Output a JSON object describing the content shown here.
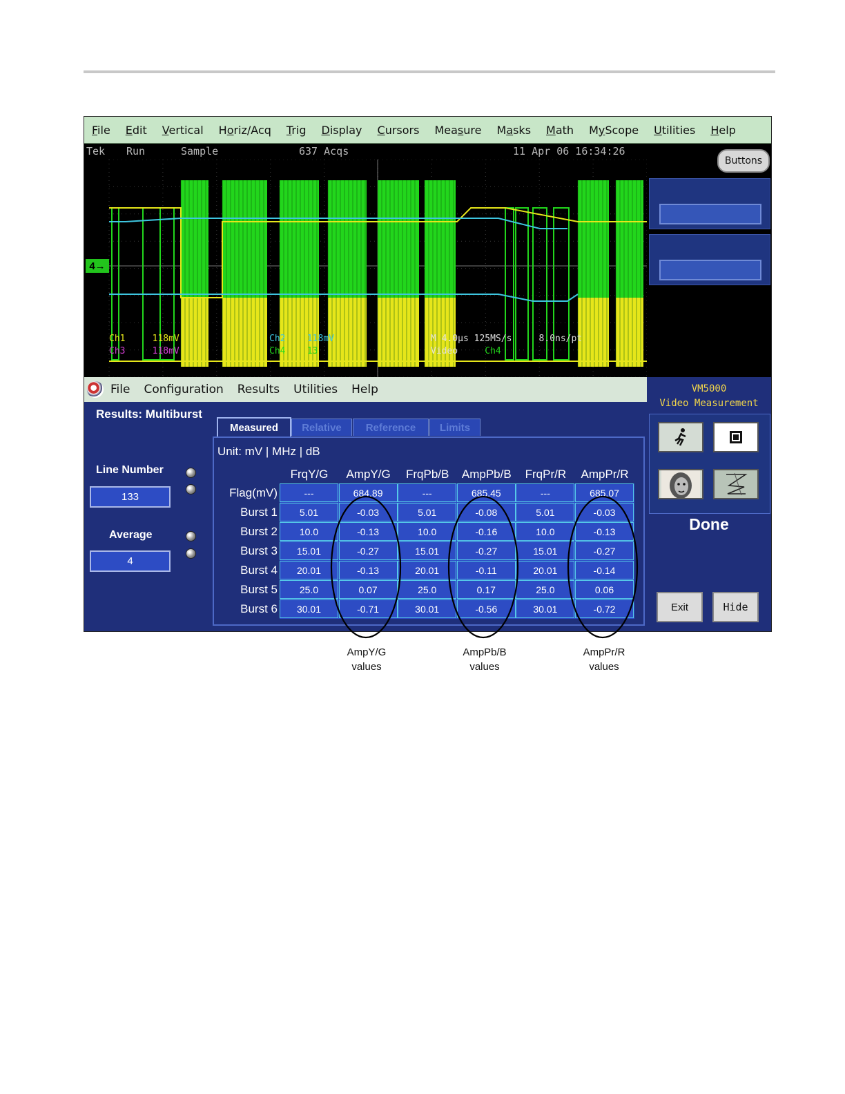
{
  "scope": {
    "menu": [
      {
        "label": "File",
        "u": "F"
      },
      {
        "label": "Edit",
        "u": "E"
      },
      {
        "label": "Vertical",
        "u": "V"
      },
      {
        "label": "Horiz/Acq",
        "u": "o"
      },
      {
        "label": "Trig",
        "u": "T"
      },
      {
        "label": "Display",
        "u": "D"
      },
      {
        "label": "Cursors",
        "u": "C"
      },
      {
        "label": "Measure",
        "u": "s"
      },
      {
        "label": "Masks",
        "u": "a"
      },
      {
        "label": "Math",
        "u": "M"
      },
      {
        "label": "MyScope",
        "u": "y"
      },
      {
        "label": "Utilities",
        "u": "U"
      },
      {
        "label": "Help",
        "u": "H"
      }
    ],
    "status": {
      "brand": "Tek",
      "mode": "Run",
      "acq": "Sample",
      "count": "637 Acqs",
      "datetime": "11 Apr 06 16:34:26"
    },
    "buttons_label": "Buttons",
    "ground_marker": "4",
    "channel_readouts": {
      "ch1": "Ch1",
      "ch1_scale": "118mV",
      "ch2": "Ch2",
      "ch2_scale": "118mV",
      "ch3": "Ch3",
      "ch3_scale": "118mV",
      "ch4": "Ch4",
      "ch4_scale": "13",
      "timebase": "M 4.0μs 125MS/s",
      "resolution": "8.0ns/pt",
      "trigger": "Video",
      "trigger_source": "Ch4"
    }
  },
  "app": {
    "menu": [
      "File",
      "Configuration",
      "Results",
      "Utilities",
      "Help"
    ],
    "title": "Results: Multiburst",
    "line_number_label": "Line Number",
    "line_number_value": "133",
    "average_label": "Average",
    "average_value": "4",
    "tabs": [
      "Measured",
      "Relative",
      "Reference",
      "Limits"
    ],
    "active_tab": "Measured",
    "unit": "Unit: mV | MHz | dB",
    "columns": [
      "FrqY/G",
      "AmpY/G",
      "FrqPb/B",
      "AmpPb/B",
      "FrqPr/R",
      "AmpPr/R"
    ],
    "rows": [
      {
        "label": "Flag(mV)",
        "values": [
          "---",
          "684.89",
          "---",
          "685.45",
          "---",
          "685.07"
        ]
      },
      {
        "label": "Burst 1",
        "values": [
          "5.01",
          "-0.03",
          "5.01",
          "-0.08",
          "5.01",
          "-0.03"
        ]
      },
      {
        "label": "Burst 2",
        "values": [
          "10.0",
          "-0.13",
          "10.0",
          "-0.16",
          "10.0",
          "-0.13"
        ]
      },
      {
        "label": "Burst 3",
        "values": [
          "15.01",
          "-0.27",
          "15.01",
          "-0.27",
          "15.01",
          "-0.27"
        ]
      },
      {
        "label": "Burst 4",
        "values": [
          "20.01",
          "-0.13",
          "20.01",
          "-0.11",
          "20.01",
          "-0.14"
        ]
      },
      {
        "label": "Burst 5",
        "values": [
          "25.0",
          "0.07",
          "25.0",
          "0.17",
          "25.0",
          "0.06"
        ]
      },
      {
        "label": "Burst 6",
        "values": [
          "30.01",
          "-0.71",
          "30.01",
          "-0.56",
          "30.01",
          "-0.72"
        ]
      }
    ]
  },
  "vm": {
    "title_line1": "VM5000",
    "title_line2": "Video Measurement",
    "status": "Done",
    "exit_label": "Exit",
    "hide_label": "Hide",
    "icons": [
      "run-icon",
      "stop-icon",
      "picture-icon",
      "waveform-icon"
    ]
  },
  "callouts": [
    {
      "line1": "AmpY/G",
      "line2": "values"
    },
    {
      "line1": "AmpPb/B",
      "line2": "values"
    },
    {
      "line1": "AmpPr/R",
      "line2": "values"
    }
  ],
  "colors": {
    "waveform_green": "#22d61c",
    "waveform_yellow": "#e6e61a",
    "trace_cyan": "#3ec6e0",
    "panel_blue": "#1f2f7a",
    "menu_green": "#c8e6c8",
    "vm_title": "#f2d64a"
  }
}
